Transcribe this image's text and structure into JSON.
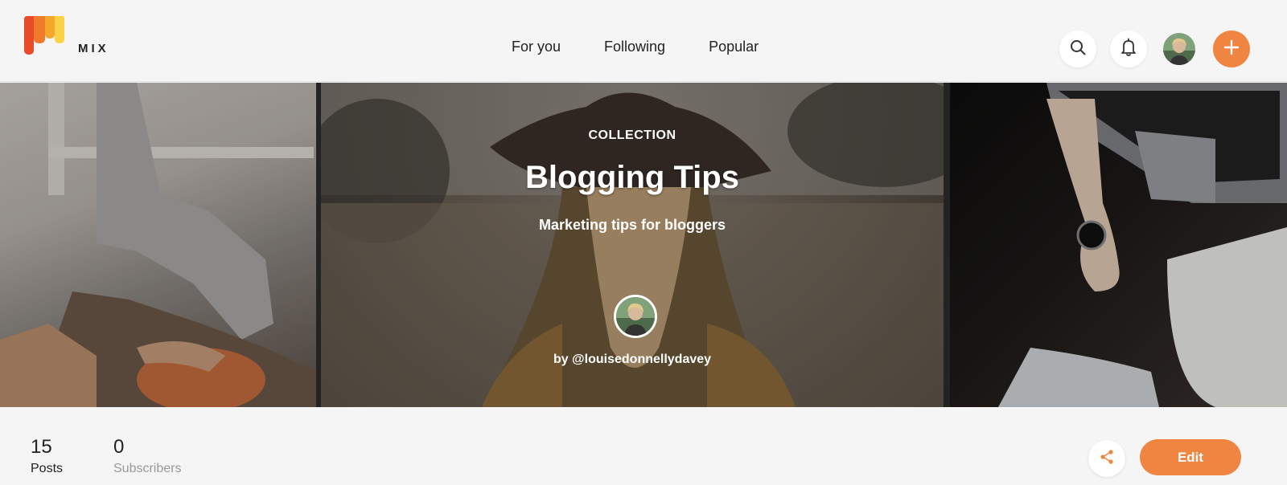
{
  "header": {
    "brand": "MIX",
    "nav": [
      {
        "label": "For you"
      },
      {
        "label": "Following"
      },
      {
        "label": "Popular"
      }
    ],
    "icons": {
      "logo": "mix-logo-icon",
      "search": "search-icon",
      "notifications": "bell-icon",
      "avatar": "user-avatar",
      "add": "plus-icon"
    }
  },
  "hero": {
    "kicker": "COLLECTION",
    "title": "Blogging Tips",
    "subtitle": "Marketing tips for bloggers",
    "author": "by @louisedonnellydavey"
  },
  "stats": {
    "posts": {
      "value": "15",
      "label": "Posts"
    },
    "subscribers": {
      "value": "0",
      "label": "Subscribers"
    }
  },
  "actions": {
    "share_icon": "share-icon",
    "edit_label": "Edit"
  },
  "colors": {
    "accent": "#ef8540",
    "background": "#f5f5f5",
    "muted_text": "#999999"
  }
}
